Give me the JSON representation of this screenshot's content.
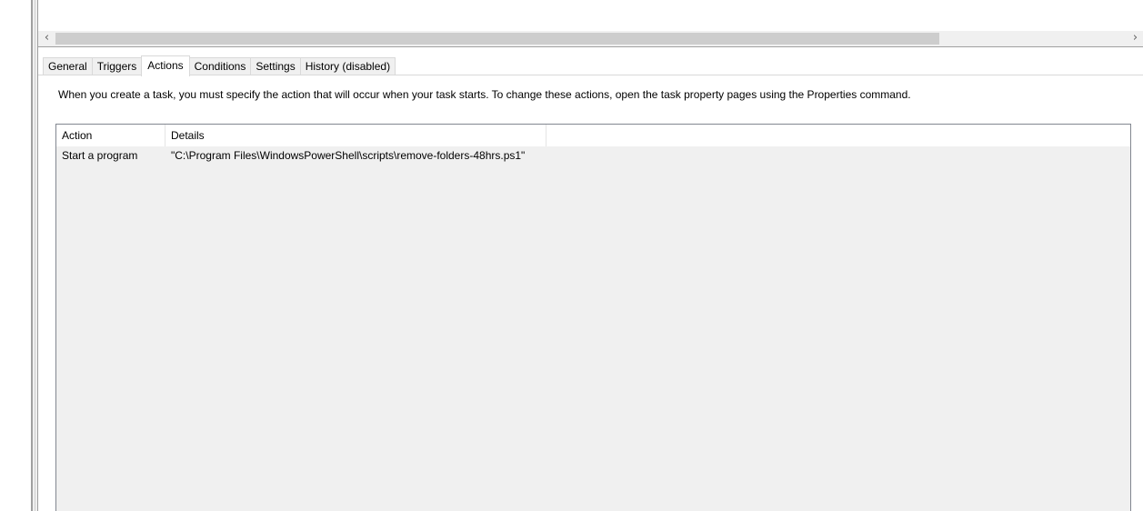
{
  "scrollbar": {
    "left_arrow": "‹",
    "right_arrow": "›"
  },
  "tabs": [
    {
      "label": "General",
      "active": false
    },
    {
      "label": "Triggers",
      "active": false
    },
    {
      "label": "Actions",
      "active": true
    },
    {
      "label": "Conditions",
      "active": false
    },
    {
      "label": "Settings",
      "active": false
    },
    {
      "label": "History (disabled)",
      "active": false
    }
  ],
  "actions_page": {
    "description": "When you create a task, you must specify the action that will occur when your task starts.  To change these actions, open the task property pages using the Properties command.",
    "columns": [
      "Action",
      "Details"
    ],
    "rows": [
      {
        "action": "Start a program",
        "details": "\"C:\\Program Files\\WindowsPowerShell\\scripts\\remove-folders-48hrs.ps1\""
      }
    ]
  },
  "colors": {
    "window_bg": "#ffffff",
    "list_bg": "#f0f0f0",
    "scrollbar_thumb": "#cdcdcd",
    "border": "#828790"
  }
}
